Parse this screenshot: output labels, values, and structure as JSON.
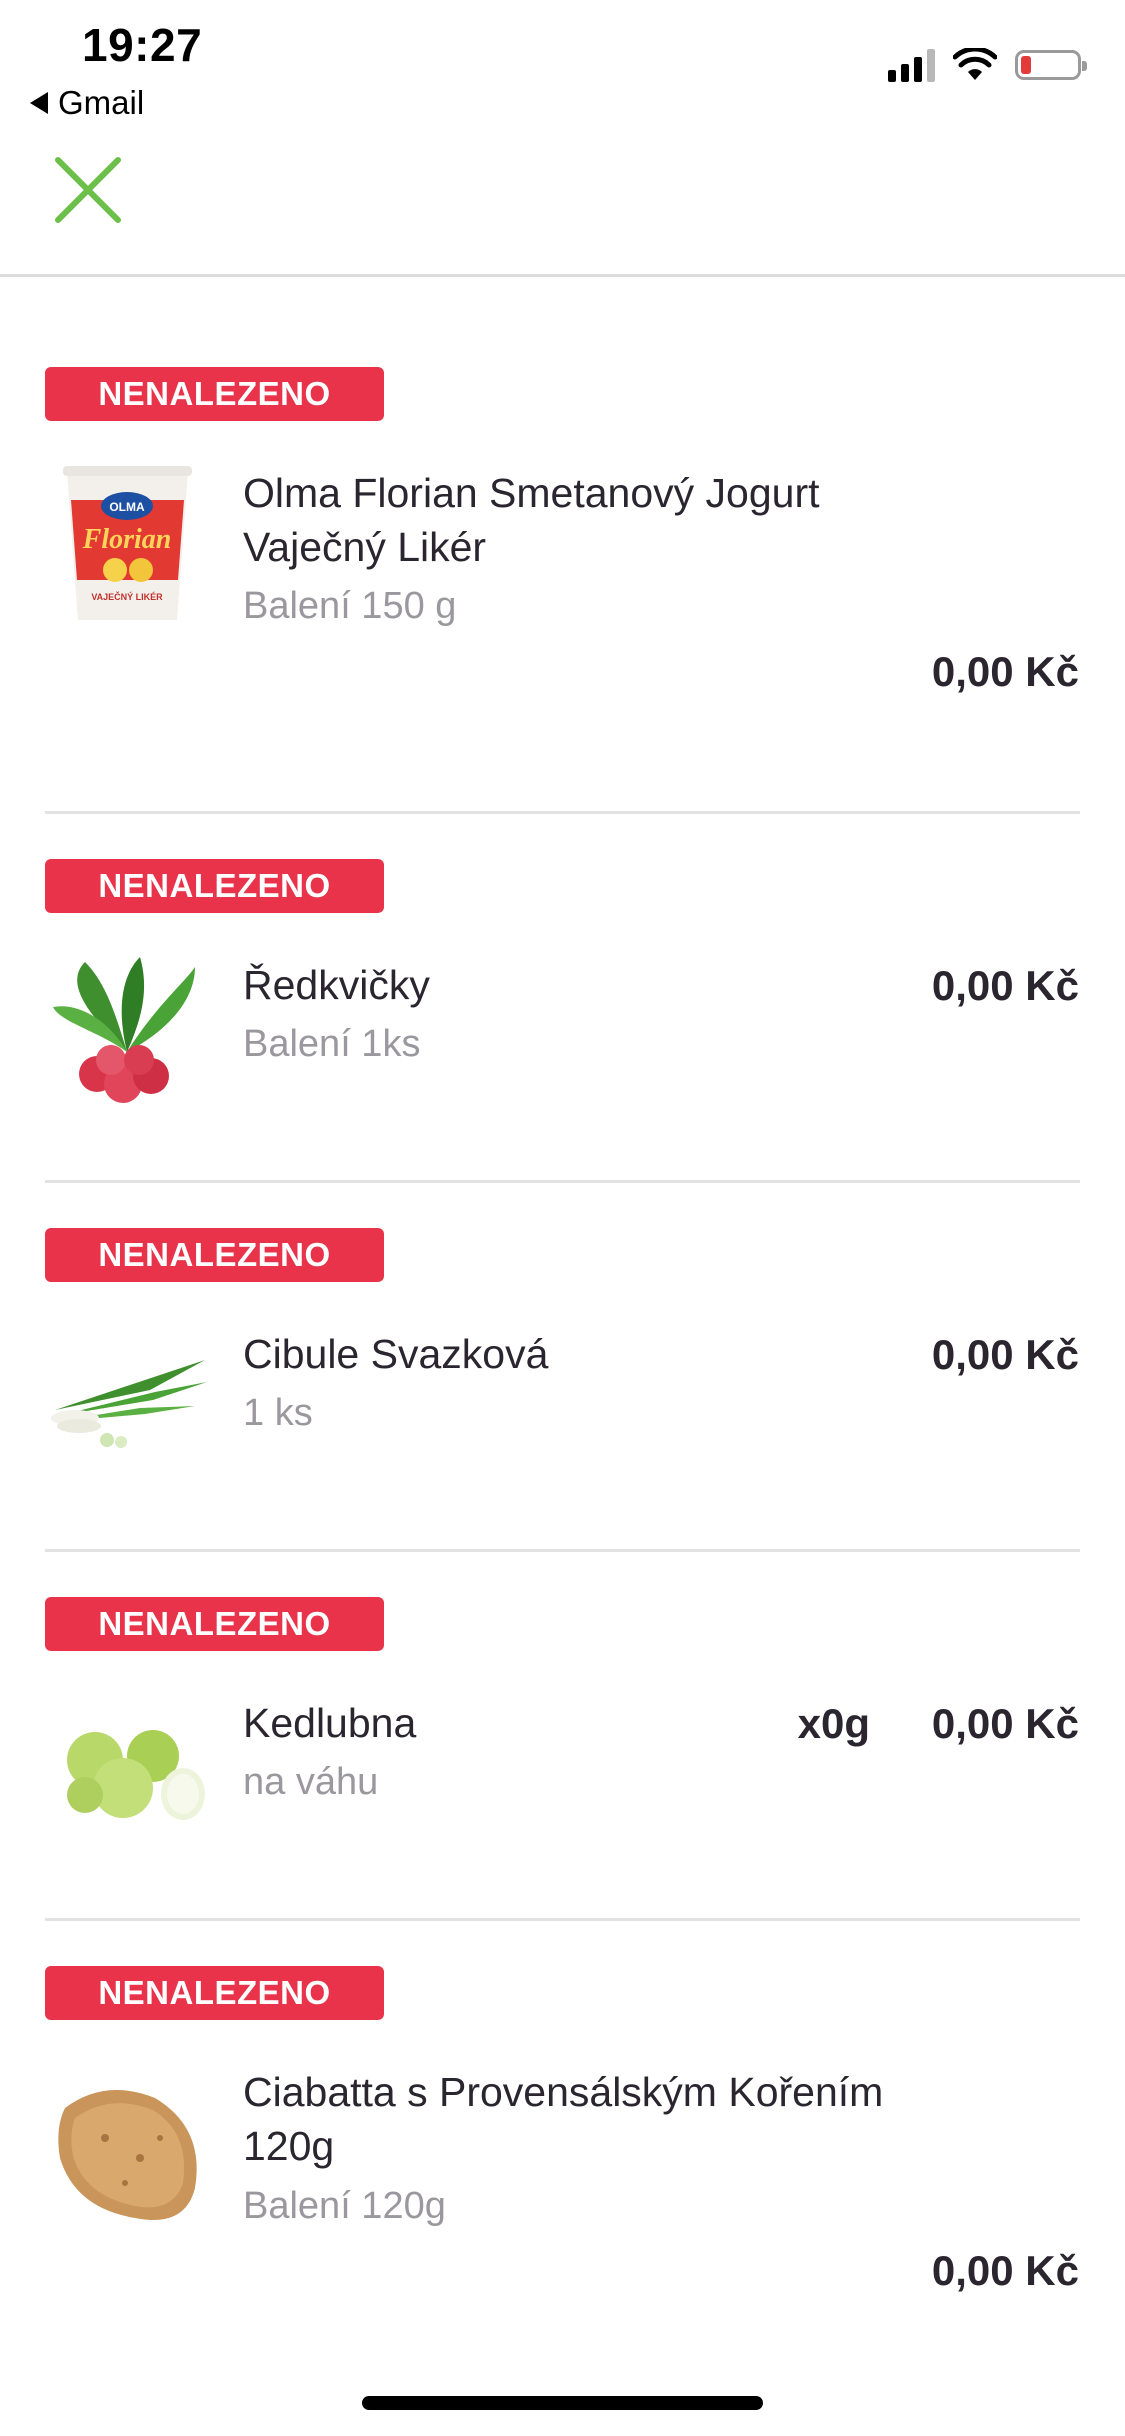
{
  "status_bar": {
    "time": "19:27",
    "back_app": "Gmail"
  },
  "badge_label": "NENALEZENO",
  "items": [
    {
      "name": "Olma Florian Smetanový Jogurt Vaječný Likér",
      "pack": "Balení 150 g",
      "price": "0,00 Kč",
      "image": "yogurt-cup"
    },
    {
      "name": "Ředkvičky",
      "pack": "Balení 1ks",
      "price": "0,00 Kč",
      "image": "radishes"
    },
    {
      "name": "Cibule Svazková",
      "pack": "1 ks",
      "price": "0,00 Kč",
      "image": "spring-onions"
    },
    {
      "name": "Kedlubna",
      "pack": "na váhu",
      "quantity": "x0g",
      "price": "0,00 Kč",
      "image": "kohlrabi"
    },
    {
      "name": "Ciabatta s Provensálským Kořením 120g",
      "pack": "Balení 120g",
      "price": "0,00 Kč",
      "image": "ciabatta"
    }
  ],
  "colors": {
    "badge": "#e8334a",
    "close_icon": "#6cc04a",
    "text": "#2b2530",
    "muted": "#9b979e"
  },
  "icons": [
    "close-icon",
    "cellular-signal-icon",
    "wifi-icon",
    "battery-icon",
    "back-triangle-icon"
  ]
}
